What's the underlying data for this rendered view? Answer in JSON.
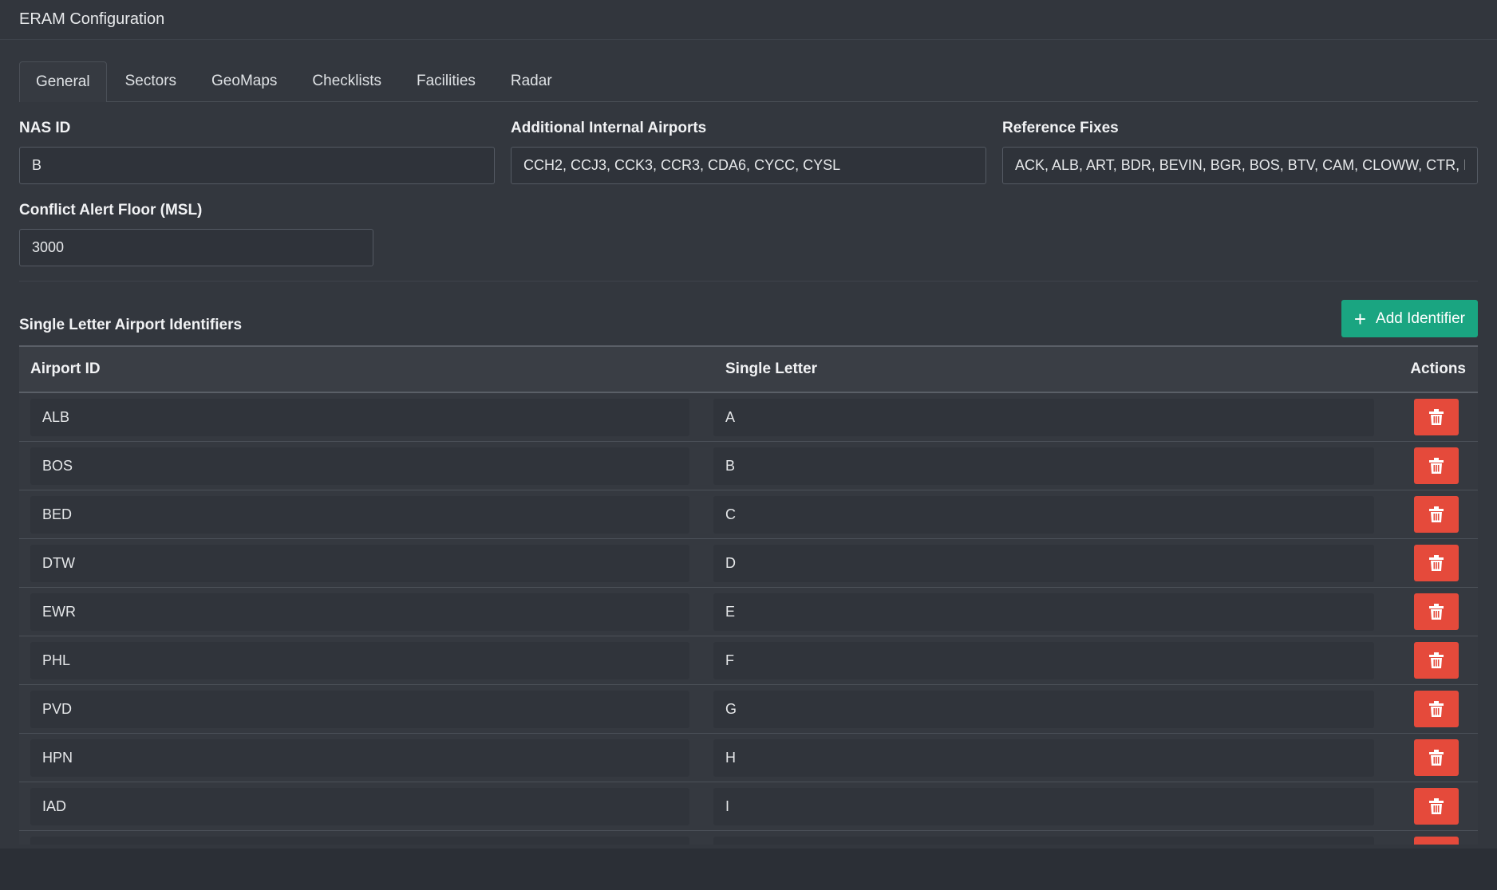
{
  "header": {
    "title": "ERAM Configuration"
  },
  "tabs": [
    {
      "label": "General",
      "active": true
    },
    {
      "label": "Sectors",
      "active": false
    },
    {
      "label": "GeoMaps",
      "active": false
    },
    {
      "label": "Checklists",
      "active": false
    },
    {
      "label": "Facilities",
      "active": false
    },
    {
      "label": "Radar",
      "active": false
    }
  ],
  "general": {
    "nas_id": {
      "label": "NAS ID",
      "value": "B"
    },
    "internal_airports": {
      "label": "Additional Internal Airports",
      "value": "CCH2, CCJ3, CCK3, CCR3, CDA6, CYCC, CYSL"
    },
    "reference_fixes": {
      "label": "Reference Fixes",
      "value": "ACK, ALB, ART, BDR, BEVIN, BGR, BOS, BTV, CAM, CLOWW, CTR, DNY, E"
    },
    "conflict_floor": {
      "label": "Conflict Alert Floor (MSL)",
      "value": "3000"
    }
  },
  "identifiers": {
    "title": "Single Letter Airport Identifiers",
    "add_label": "Add Identifier",
    "columns": {
      "airport": "Airport ID",
      "letter": "Single Letter",
      "actions": "Actions"
    },
    "rows": [
      {
        "airport": "ALB",
        "letter": "A"
      },
      {
        "airport": "BOS",
        "letter": "B"
      },
      {
        "airport": "BED",
        "letter": "C"
      },
      {
        "airport": "DTW",
        "letter": "D"
      },
      {
        "airport": "EWR",
        "letter": "E"
      },
      {
        "airport": "PHL",
        "letter": "F"
      },
      {
        "airport": "PVD",
        "letter": "G"
      },
      {
        "airport": "HPN",
        "letter": "H"
      },
      {
        "airport": "IAD",
        "letter": "I"
      },
      {
        "airport": "",
        "letter": ""
      }
    ]
  },
  "colors": {
    "add_button": "#1aa581",
    "delete_button": "#e54a3b",
    "background": "#33373e"
  },
  "icons": {
    "add": "plus-icon",
    "delete": "trash-icon"
  }
}
